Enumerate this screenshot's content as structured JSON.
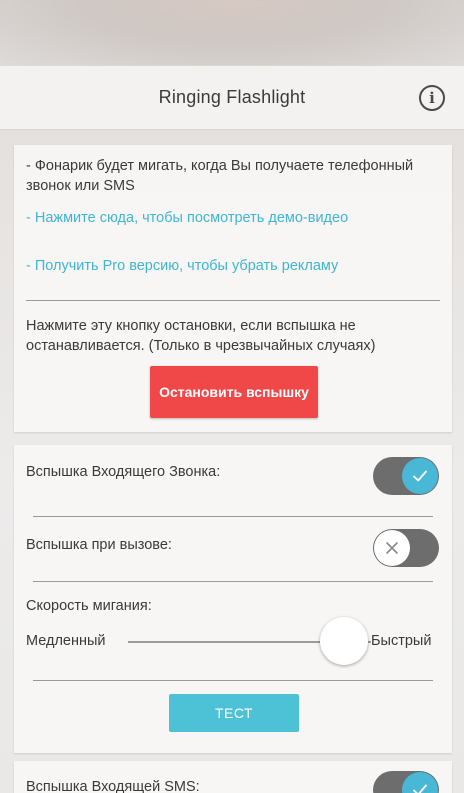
{
  "app": {
    "title": "Ringing Flashlight",
    "info_icon": "info-icon"
  },
  "info_card": {
    "description": "- Фонарик будет мигать, когда Вы получаете телефонный звонок или SMS",
    "demo_link": "- Нажмите сюда, чтобы посмотреть демо-видео",
    "pro_link": "- Получить Pro версию, чтобы убрать рекламу",
    "stop_hint": "Нажмите эту кнопку остановки, если вспышка не останавливается. (Только в чрезвычайных случаях)",
    "stop_button": "Остановить вспышку"
  },
  "call_settings": {
    "incoming_call_label": "Вспышка Входящего Звонка:",
    "incoming_call_enabled": true,
    "outgoing_call_label": "Вспышка при вызове:",
    "outgoing_call_enabled": false,
    "speed_label": "Скорость мигания:",
    "speed_min_label": "Медленный",
    "speed_max_label": "Быстрый",
    "speed_value_fraction": 0.89,
    "test_button": "ТЕСТ"
  },
  "sms_settings": {
    "incoming_sms_label": "Вспышка Входящей SMS:",
    "incoming_sms_enabled": true
  },
  "colors": {
    "accent": "#49b8d6",
    "link": "#3fb5d3",
    "stop_button": "#f04848",
    "test_button": "#4dc2d6"
  }
}
